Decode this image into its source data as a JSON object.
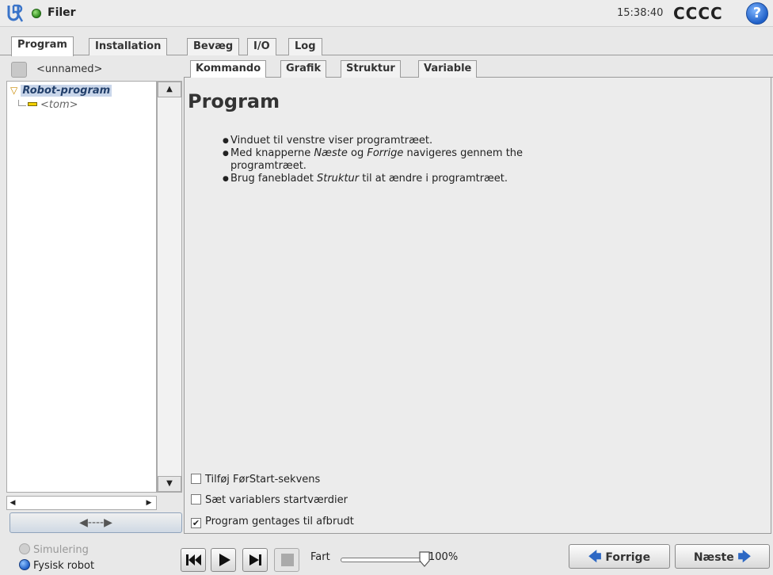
{
  "topbar": {
    "app_title": "Filer",
    "clock": "15:38:40",
    "robot_name": "CCCC",
    "help_glyph": "?"
  },
  "main_tabs": [
    {
      "label": "Program",
      "active": true
    },
    {
      "label": "Installation",
      "active": false
    },
    {
      "label": "Bevæg",
      "active": false
    },
    {
      "label": "I/O",
      "active": false
    },
    {
      "label": "Log",
      "active": false
    }
  ],
  "left_panel": {
    "program_name": "<unnamed>",
    "tree_root": "Robot-program",
    "tree_child": "<tom>",
    "collapse_glyph": "◀----▶"
  },
  "sub_tabs": [
    {
      "label": "Kommando",
      "active": true
    },
    {
      "label": "Grafik",
      "active": false
    },
    {
      "label": "Struktur",
      "active": false
    },
    {
      "label": "Variable",
      "active": false
    }
  ],
  "content": {
    "title": "Program",
    "bullet1": "Vinduet til venstre viser programtræet.",
    "bullet2_pre": "Med knapperne ",
    "bullet2_em1": "Næste",
    "bullet2_mid": " og ",
    "bullet2_em2": "Forrige",
    "bullet2_post": " navigeres gennem the programtræet.",
    "bullet3_pre": "Brug fanebladet ",
    "bullet3_em": "Struktur",
    "bullet3_post": " til at ændre i programtræet.",
    "checkboxes": [
      {
        "label": "Tilføj FørStart-sekvens",
        "checked": false
      },
      {
        "label": "Sæt variablers startværdier",
        "checked": false
      },
      {
        "label": "Program gentages til afbrudt",
        "checked": true
      }
    ]
  },
  "bottom": {
    "mode_sim": "Simulering",
    "mode_real": "Fysisk robot",
    "speed_label": "Fart",
    "speed_value": "100%",
    "speed_fraction": 1.0,
    "prev_label": "Forrige",
    "next_label": "Næste"
  },
  "colors": {
    "accent_blue": "#2d68c4",
    "status_green": "#2e8b1d",
    "tree_highlight": "#c9d6ea"
  }
}
